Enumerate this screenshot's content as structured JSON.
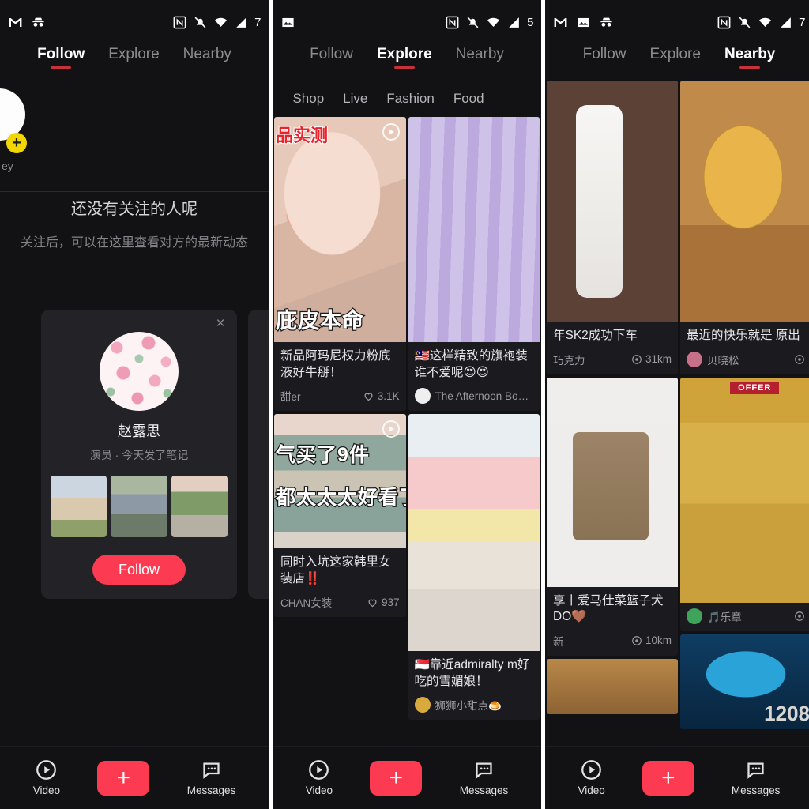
{
  "status_bar": {
    "icons_left_p1": [
      "gmail-icon",
      "incognito-icon"
    ],
    "icons_left_p2": [
      "photo-icon"
    ],
    "icons_left_p3": [
      "gmail-icon",
      "photo-icon",
      "incognito-icon"
    ],
    "icons_right": [
      "nfc-icon",
      "notifications-off-icon",
      "wifi-icon",
      "signal-icon"
    ],
    "battery_p1": "7",
    "battery_p2": "5",
    "battery_p3": "7"
  },
  "top_tabs": {
    "items": [
      {
        "label": "Follow"
      },
      {
        "label": "Explore"
      },
      {
        "label": "Nearby"
      }
    ],
    "active_p1": "Follow",
    "active_p2": "Explore",
    "active_p3": "Nearby",
    "underline_color": "#c8303c"
  },
  "panel1": {
    "story": {
      "name_clipped": "ey",
      "add_badge": "+"
    },
    "empty_state": {
      "title": "还没有关注的人呢",
      "subtitle": "关注后，可以在这里查看对方的最新动态"
    },
    "suggestion_card": {
      "close_label": "×",
      "name": "赵露思",
      "meta": "演员 · 今天发了笔记",
      "follow_label": "Follow",
      "follow_color": "#fc3b52",
      "thumbnail_count": 3
    }
  },
  "panel2": {
    "categories": [
      "u",
      "Shop",
      "Live",
      "Fashion",
      "Food"
    ],
    "cards": [
      {
        "overlay_top": "品实测",
        "overlay_bottom": "庇皮本命",
        "has_play_badge": true,
        "caption": "新品阿玛尼权力粉底液好牛掰！",
        "user": "甜er",
        "likes": "3.1K",
        "like_icon": "heart-icon",
        "photo": "ph-face"
      },
      {
        "caption": "🇲🇾这样精致的旗袍装谁不爱呢😍😍",
        "user": "The Afternoon Bout...",
        "photo": "ph-cloth"
      },
      {
        "overlay_top": "气买了9件",
        "overlay_bottom": "都太太太好看了",
        "has_play_badge": true,
        "caption": "同时入坑这家韩里女装店‼️",
        "user": "CHAN女装",
        "likes": "937",
        "like_icon": "heart-icon",
        "photo": "ph-knit"
      },
      {
        "caption": "🇸🇬靠近admiralty m好吃的雪媚娘！",
        "user": "狮狮小甜点🍮",
        "photo": "ph-mochi"
      }
    ]
  },
  "panel3": {
    "cards": [
      {
        "caption": "年SK2成功下车",
        "user": "巧克力",
        "distance": "31km",
        "distance_icon": "location-pin-icon",
        "photo": "ph-skii"
      },
      {
        "caption": "最近的快乐就是 原出",
        "user": "贝晓松",
        "photo": "ph-soup"
      },
      {
        "caption": "享丨爱马仕菜篮子犬DO🤎",
        "user": "新",
        "distance": "10km",
        "distance_icon": "location-pin-icon",
        "photo": "ph-bag"
      },
      {
        "caption": "",
        "user": "🎵乐章",
        "photo": "ph-shelf"
      },
      {
        "overlay_number": "1208",
        "photo": "ph-stage"
      }
    ]
  },
  "bottom_nav": {
    "video_label": "Video",
    "video_icon": "play-circle-icon",
    "plus_label": "+",
    "plus_color": "#fc3b52",
    "messages_label": "Messages",
    "messages_icon": "chat-bubble-icon"
  }
}
